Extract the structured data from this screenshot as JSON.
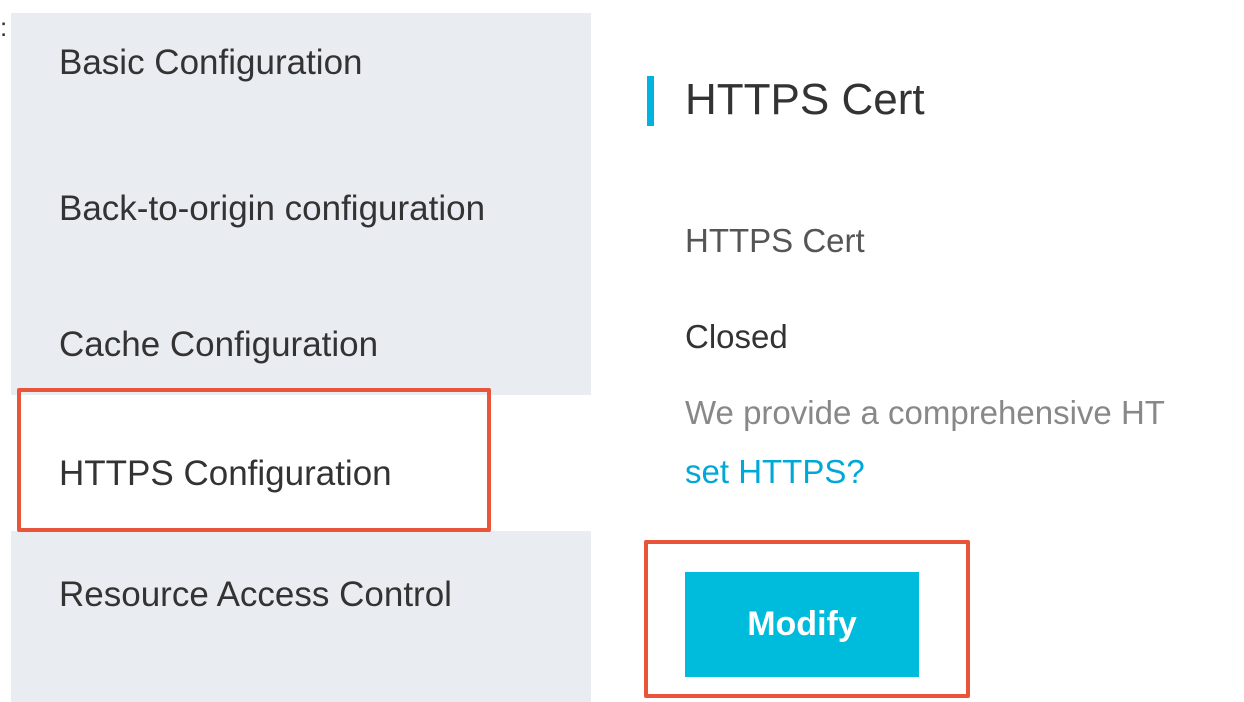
{
  "corner_fragment": ":",
  "sidebar": {
    "items": [
      {
        "label": "Basic Configuration"
      },
      {
        "label": "Back-to-origin configuration"
      },
      {
        "label": "Cache Configuration"
      },
      {
        "label": "HTTPS Configuration",
        "active": true
      },
      {
        "label": "Resource Access Control"
      }
    ]
  },
  "main": {
    "section_title": "HTTPS Cert",
    "field_label": "HTTPS Cert",
    "field_value": "Closed",
    "description": "We provide a comprehensive HT",
    "help_link": "set HTTPS?",
    "modify_label": "Modify"
  },
  "colors": {
    "accent": "#00b4e0",
    "button": "#00bcdc",
    "link": "#00a8d8",
    "sidebar_bg": "#e9ecf1",
    "highlight": "#e8553a"
  }
}
